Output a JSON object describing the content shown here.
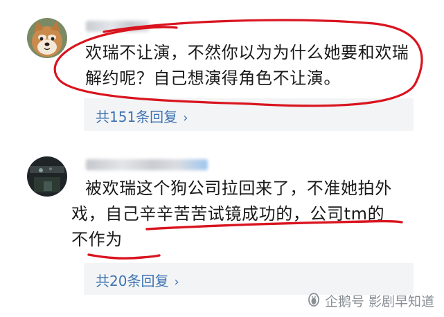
{
  "comments": [
    {
      "text": "欢瑞不让演，不然你以为为什么她要和欢瑞解约呢？自己想演得角色不让演。",
      "reply_link": "共151条回复"
    },
    {
      "line1": "被欢瑞这个狗公司拉回来了，不准她拍外",
      "line2": "戏，自己辛辛苦苦试镜成功的，公司tm的",
      "line3": "不作为",
      "reply_link": "共20条回复"
    }
  ],
  "reply_arrow": "›",
  "watermark": {
    "source": "企鹅号",
    "account": "影剧早知道"
  },
  "colors": {
    "annotation_red": "#d9141f",
    "reply_link_blue": "#3e73b0",
    "reply_box_bg": "#f3f4f6"
  },
  "icons": [
    "avatar-shiba-icon",
    "avatar-dark-photo-icon",
    "penguin-logo-icon",
    "chevron-right-icon"
  ]
}
